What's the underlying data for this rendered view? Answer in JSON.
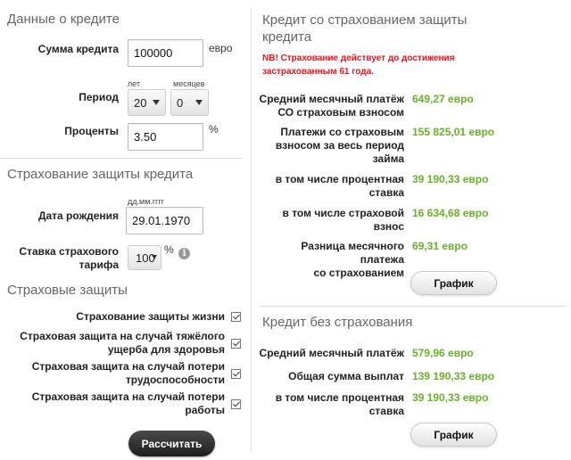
{
  "credit": {
    "section_title": "Данные о кредите",
    "amount_label": "Сумма кредита",
    "amount_value": "100000",
    "amount_unit": "евро",
    "period_label": "Период",
    "years_label": "лет",
    "months_label": "месяцев",
    "years_value": "20",
    "months_value": "0",
    "interest_label": "Проценты",
    "interest_value": "3.50",
    "interest_unit": "%"
  },
  "insurance": {
    "section_title": "Страхование защиты кредита",
    "birth_format": "дд.мм.гггг",
    "birth_label": "Дата рождения",
    "birth_value": "29.01.1970",
    "rate_label_1": "Ставка страхового",
    "rate_label_2": "тарифа",
    "rate_value": "100",
    "rate_unit": "%"
  },
  "protections": {
    "section_title": "Страховые защиты",
    "items": [
      {
        "label": "Страхование защиты жизни",
        "checked": true
      },
      {
        "label_1": "Страховая защита на случай тяжёлого",
        "label_2": "ущерба для здоровья",
        "checked": true
      },
      {
        "label_1": "Страховая защита на случай потери",
        "label_2": "трудоспособности",
        "checked": true
      },
      {
        "label_1": "Страховая защита на случай потери",
        "label_2": "работы",
        "checked": true
      }
    ]
  },
  "calculate_label": "Рассчитать",
  "with_insurance": {
    "title_1": "Кредит со страхованием защиты",
    "title_2": "кредита",
    "note_1": "NB! Страхование действует до достижения",
    "note_2": "застрахованным 61 года.",
    "rows": [
      {
        "label_1": "Средний месячный платёж",
        "label_2": "СО страховым взносом",
        "value": "649,27 евро"
      },
      {
        "label_1": "Платежи со страховым",
        "label_2": "взносом за весь период",
        "label_3": "займа",
        "value": "155 825,01 евро"
      },
      {
        "label_1": "в том числе процентная",
        "label_2": "ставка",
        "value": "39 190,33 евро"
      },
      {
        "label_1": "в том числе страховой",
        "label_2": "взнос",
        "value": "16 634,68 евро"
      },
      {
        "label_1": "Разница месячного платежа",
        "label_2": "со страхованием",
        "value": "69,31 евро"
      }
    ],
    "graph_label": "График"
  },
  "without_insurance": {
    "title": "Кредит без страхования",
    "rows": [
      {
        "label_1": "Средний месячный платёж",
        "value": "579,96 евро"
      },
      {
        "label_1": "Общая сумма выплат",
        "value": "139 190,33 евро"
      },
      {
        "label_1": "в том числе процентная",
        "label_2": "ставка",
        "value": "39 190,33 евро"
      }
    ],
    "graph_label": "График"
  },
  "colors": {
    "accent_green": "#6ab02d",
    "note_red": "#e8141e",
    "button_dark": "#2a2a2a"
  }
}
